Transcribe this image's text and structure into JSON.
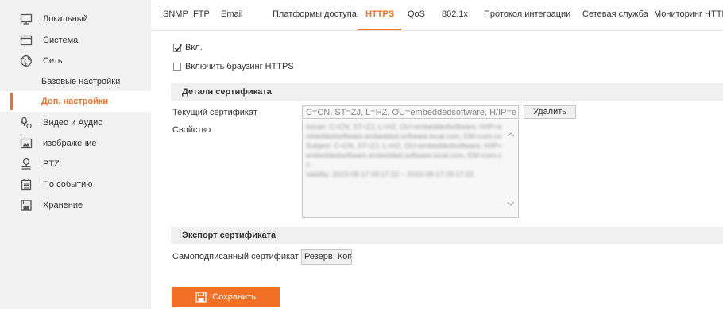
{
  "sidebar": {
    "items": [
      {
        "label": "Локальный",
        "icon": "monitor-icon"
      },
      {
        "label": "Система",
        "icon": "window-icon"
      },
      {
        "label": "Сеть",
        "icon": "globe-icon"
      },
      {
        "label": "Базовые настройки"
      },
      {
        "label": "Доп. настройки"
      },
      {
        "label": "Видео и Аудио",
        "icon": "video-audio-icon"
      },
      {
        "label": "изображение",
        "icon": "image-icon"
      },
      {
        "label": "PTZ",
        "icon": "ptz-icon"
      },
      {
        "label": "По событию",
        "icon": "event-icon"
      },
      {
        "label": "Хранение",
        "icon": "storage-icon"
      }
    ],
    "active_index": 4
  },
  "tabs": [
    "SNMP",
    "FTP",
    "Email",
    "Платформы доступа",
    "HTTPS",
    "QoS",
    "802.1x",
    "Протокол интеграции",
    "Сетевая служба",
    "Мониторинг HTTP"
  ],
  "active_tab": "HTTPS",
  "form": {
    "enable_label": "Вкл.",
    "enable_checked": true,
    "https_browsing_label": "Включить браузинг HTTPS",
    "https_browsing_checked": false,
    "cert_details_title": "Детали сертификата",
    "current_cert_label": "Текущий сертификат",
    "current_cert_value": "C=CN, ST=ZJ, L=HZ, OU=embeddedsoftware, H/IP=e",
    "delete_button": "Удалить",
    "property_label": "Свойство",
    "property_text": "Issuer: C=CN, ST=ZJ, L=HZ, OU=embeddedsoftware, H/IP=embeddedsoftware.embedded.software.local.com, EM=com.cn\nSubject: C=CN, ST=ZJ, L=HZ, OU=embeddedsoftware, H/IP=embeddedsoftware.embedded.software.local.com, EM=com.cn\nValidity: 2023-08-17 09:17:22 ~ 2033-08-17 09:17:22",
    "export_title": "Экспорт сертификата",
    "self_signed_label": "Самоподписанный сертификат",
    "backup_button": "Резерв. Копи",
    "save_button": "Сохранить"
  },
  "colors": {
    "accent": "#f27025",
    "sidebar_bg": "#f2f2f2",
    "section_bg": "#f0f0f0"
  }
}
